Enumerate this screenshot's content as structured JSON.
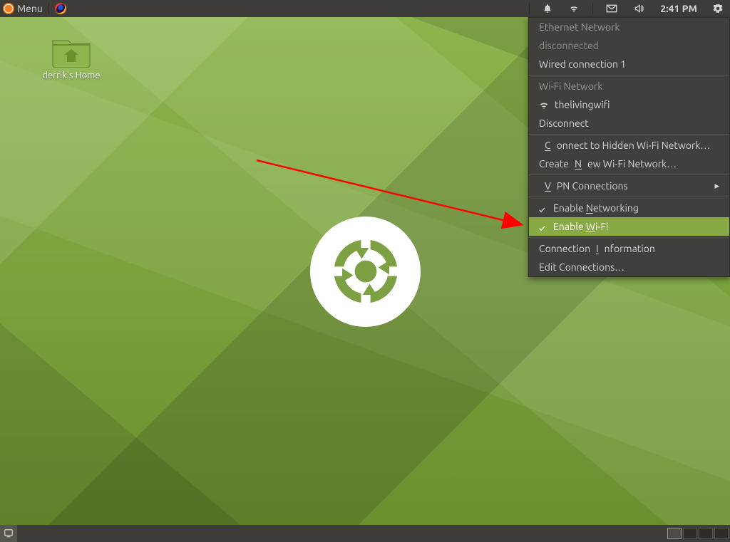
{
  "top_panel": {
    "menu_label": "Menu",
    "clock": "2:41 PM"
  },
  "desktop": {
    "home_icon_label": "derrik's Home"
  },
  "network_menu": {
    "ethernet_header": "Ethernet Network",
    "ethernet_status": "disconnected",
    "wired_conn": "Wired connection 1",
    "wifi_header": "Wi-Fi Network",
    "wifi_ssid": "thelivingwifi",
    "disconnect": "Disconnect",
    "connect_hidden": {
      "pre": "",
      "ul": "C",
      "post": "onnect to Hidden Wi-Fi Network…"
    },
    "create_new": {
      "pre": "Create ",
      "ul": "N",
      "post": "ew Wi-Fi Network…"
    },
    "vpn": {
      "pre": "",
      "ul": "V",
      "post": "PN Connections"
    },
    "enable_net": {
      "pre": "Enable ",
      "ul": "N",
      "post": "etworking"
    },
    "enable_wifi": {
      "pre": "Enable ",
      "ul": "W",
      "post": "i-Fi"
    },
    "conn_info": {
      "pre": "Connection ",
      "ul": "I",
      "post": "nformation"
    },
    "edit_conn": "Edit Connections…"
  }
}
